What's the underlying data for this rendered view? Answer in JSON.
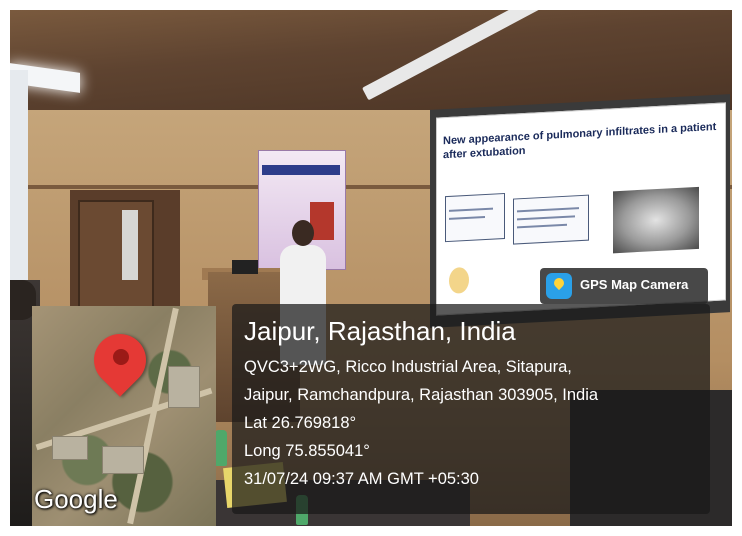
{
  "gps_badge": {
    "label": "GPS Map Camera",
    "icon": "gps-map-camera-app-icon"
  },
  "location": {
    "title": "Jaipur, Rajasthan, India",
    "address_line1": "QVC3+2WG, Ricco Industrial Area, Sitapura,",
    "address_line2": "Jaipur, Ramchandpura, Rajasthan 303905, India",
    "latitude": "Lat 26.769818°",
    "longitude": "Long 75.855041°",
    "timestamp": "31/07/24 09:37 AM GMT +05:30"
  },
  "map": {
    "provider_logo": "Google",
    "pin_icon": "map-pin-icon",
    "pin_color": "#e53935"
  },
  "slide": {
    "title": "New appearance of pulmonary infiltrates in a patient after extubation"
  },
  "colors": {
    "overlay_bg": "#191919",
    "overlay_text": "#ffffff",
    "badge_icon": "#2aa0e8"
  }
}
